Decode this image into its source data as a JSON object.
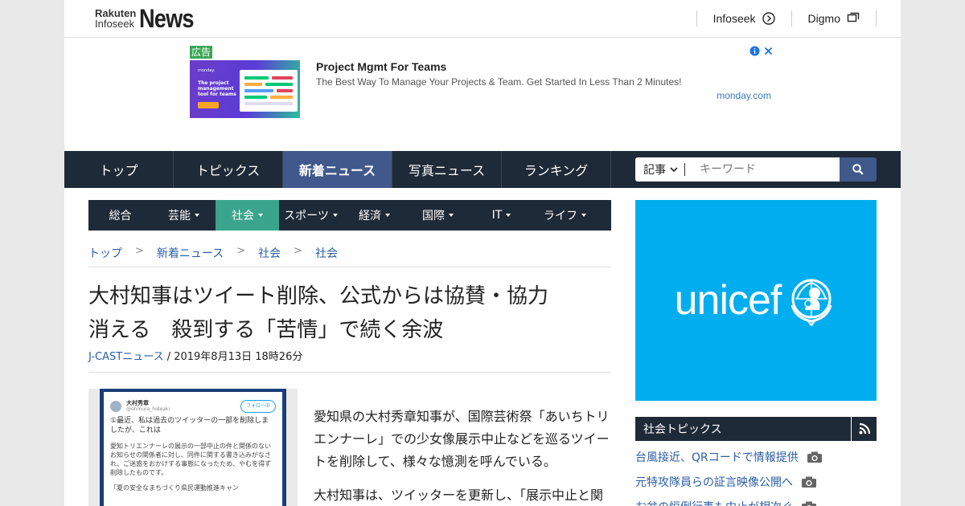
{
  "header": {
    "logo_line1": "Rakuten",
    "logo_line2": "Infoseek",
    "logo_main": "News",
    "links": [
      {
        "label": "Infoseek",
        "icon": "arrow-circle-icon"
      },
      {
        "label": "Digmo",
        "icon": "windows-icon"
      }
    ]
  },
  "ad": {
    "badge": "広告",
    "title": "Project Mgmt For Teams",
    "description": "The Best Way To Manage Your Projects & Team. Get Started In Less Than 2 Minutes!",
    "domain": "monday.com"
  },
  "nav": {
    "items": [
      "トップ",
      "トピックス",
      "新着ニュース",
      "写真ニュース",
      "ランキング"
    ],
    "active_index": 2
  },
  "search": {
    "scope": "記事",
    "placeholder": "キーワード"
  },
  "categories": {
    "items": [
      "総合",
      "芸能",
      "社会",
      "スポーツ",
      "経済",
      "国際",
      "IT",
      "ライフ"
    ],
    "active_index": 2
  },
  "breadcrumb": [
    "トップ",
    "新着ニュース",
    "社会",
    "社会"
  ],
  "article": {
    "title_line1": "大村知事はツイート削除、公式からは協賛・協力",
    "title_line2": "消える　殺到する「苦情」で続く余波",
    "source": "J-CASTニュース",
    "date": " / 2019年8月13日 18時26分",
    "paragraph1": "愛知県の大村秀章知事が、国際芸術祭「あいちトリエンナーレ」での少女像展示中止などを巡るツイートを削除して、様々な憶測を呼んでいる。",
    "paragraph2": "大村知事は、ツイッターを更新し、「展示中止と関",
    "tweet": {
      "name": "大村秀章",
      "handle": "@ohmura_hideaki",
      "follow": "フォロー中",
      "line1": "①最近、私は過去のツイッターの一部を削除しましたが、これは",
      "line2": "愛知トリエンナーレの展示の一部中止の件と関係のないお知らせの関係者に対し、同件に関する書き込みがなされ、ご迷惑をおかけする事態になったため、やむを得ず削除したものです。",
      "line3": "「夏の安全なまちづくり県民運動推進キャン"
    }
  },
  "banner": {
    "text": "unicef"
  },
  "topics": {
    "title": "社会トピックス",
    "items": [
      "台風接近、QRコードで情報提供",
      "元特攻隊員らの証言映像公開へ",
      "お盆の恒例行事も中止が相次ぐ"
    ]
  },
  "colors": {
    "nav_bg": "#1f2a38",
    "nav_active": "#40588c",
    "category_active": "#3aa58c",
    "link": "#2a5ea6",
    "banner_bg": "#00aeef",
    "ad_badge": "#3aa757"
  }
}
